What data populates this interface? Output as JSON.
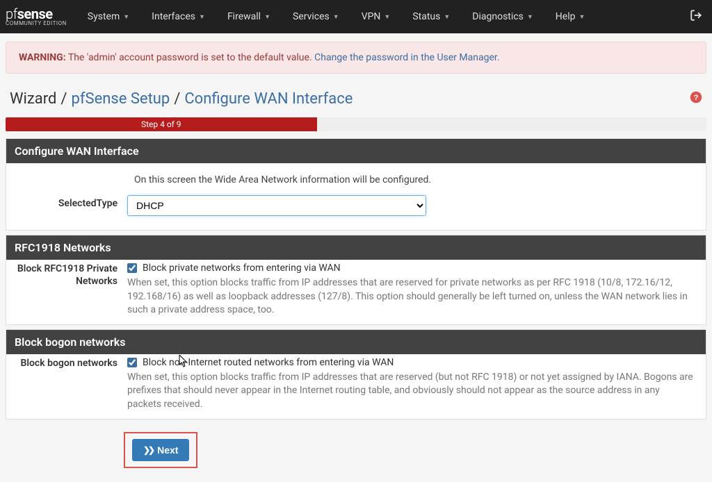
{
  "nav": {
    "items": [
      "System",
      "Interfaces",
      "Firewall",
      "Services",
      "VPN",
      "Status",
      "Diagnostics",
      "Help"
    ],
    "logo_main_pf": "pf",
    "logo_main_sense": "sense",
    "logo_sub": "COMMUNITY EDITION"
  },
  "alert": {
    "prefix": "WARNING:",
    "text": " The 'admin' account password is set to the default value. ",
    "link": "Change the password in the User Manager."
  },
  "breadcrumb": {
    "root": "Wizard",
    "mid": "pfSense Setup",
    "leaf": "Configure WAN Interface"
  },
  "progress": {
    "label": "Step 4 of 9"
  },
  "panel1": {
    "title": "Configure WAN Interface",
    "desc": "On this screen the Wide Area Network information will be configured.",
    "type_label": "SelectedType",
    "type_value": "DHCP"
  },
  "panel2": {
    "title": "RFC1918 Networks",
    "field_label": "Block RFC1918 Private Networks",
    "checkbox_text": "Block private networks from entering via WAN",
    "help": "When set, this option blocks traffic from IP addresses that are reserved for private networks as per RFC 1918 (10/8, 172.16/12, 192.168/16) as well as loopback addresses (127/8). This option should generally be left turned on, unless the WAN network lies in such a private address space, too."
  },
  "panel3": {
    "title": "Block bogon networks",
    "field_label": "Block bogon networks",
    "checkbox_text": "Block non-Internet routed networks from entering via WAN",
    "help": "When set, this option blocks traffic from IP addresses that are reserved (but not RFC 1918) or not yet assigned by IANA. Bogons are prefixes that should never appear in the Internet routing table, and obviously should not appear as the source address in any packets received."
  },
  "buttons": {
    "next": "Next"
  }
}
